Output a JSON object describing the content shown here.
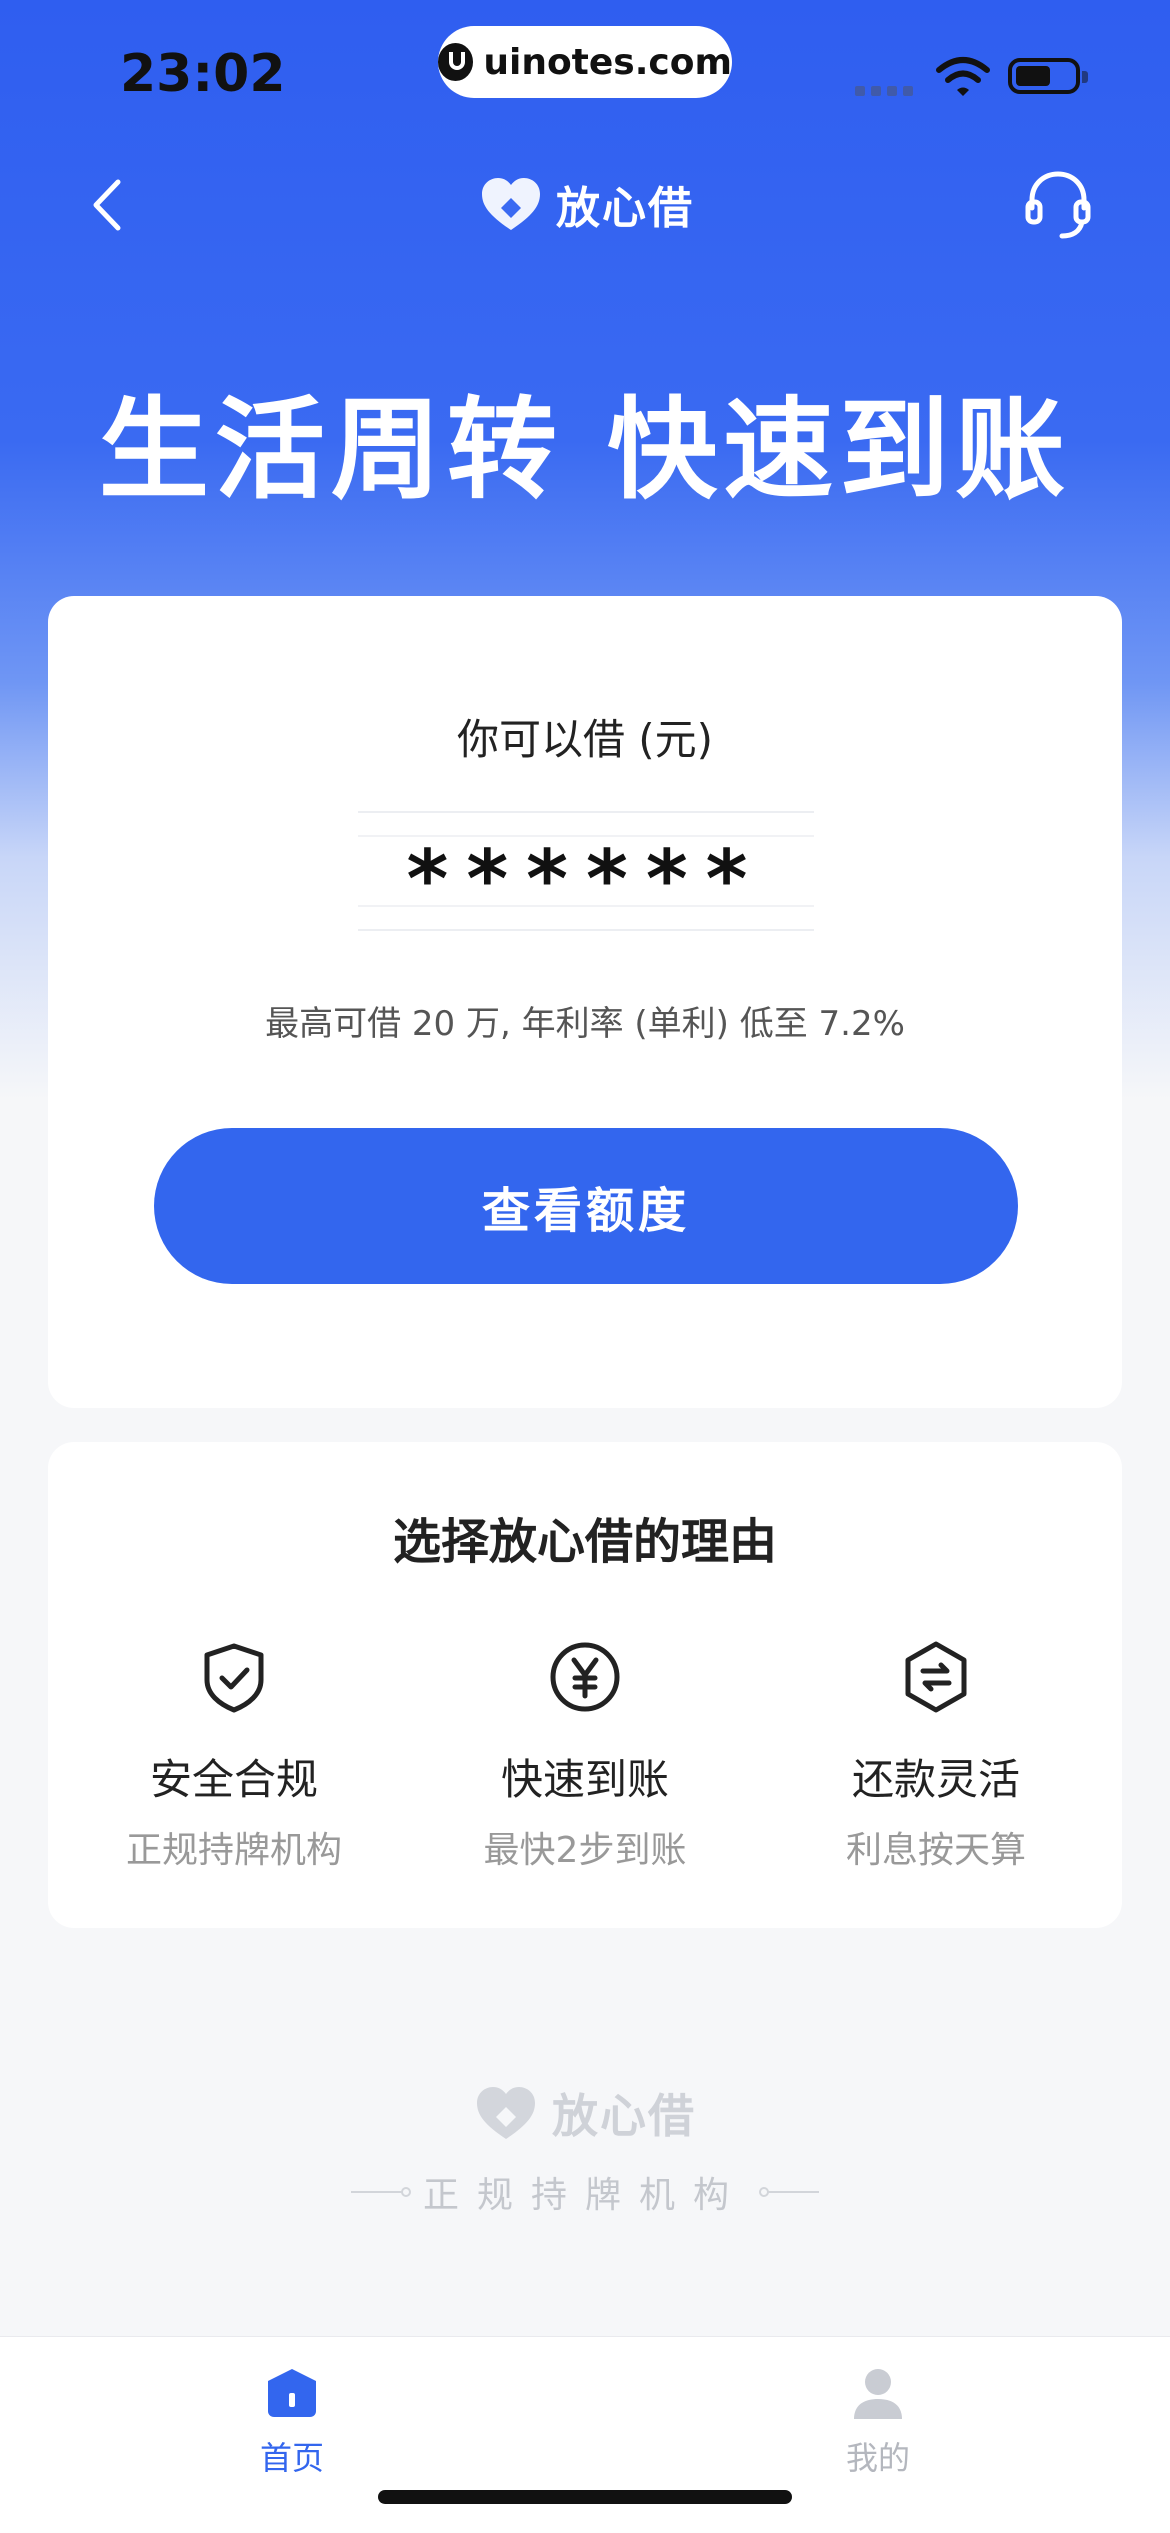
{
  "status_bar": {
    "time": "23:02",
    "url": "uinotes.com"
  },
  "nav": {
    "brand": "放心借",
    "back_icon": "chevron-left-icon",
    "support_icon": "headset-icon"
  },
  "hero": {
    "headline": "生活周转 快速到账"
  },
  "loan_card": {
    "label": "你可以借 (元)",
    "amount_masked": "******",
    "rate_note": "最高可借 20 万, 年利率 (单利) 低至 7.2%",
    "cta": "查看额度"
  },
  "reasons": {
    "title": "选择放心借的理由",
    "items": [
      {
        "title": "安全合规",
        "subtitle": "正规持牌机构",
        "icon": "shield-check-icon"
      },
      {
        "title": "快速到账",
        "subtitle": "最快2步到账",
        "icon": "yuan-circle-icon"
      },
      {
        "title": "还款灵活",
        "subtitle": "利息按天算",
        "icon": "hexagon-swap-icon"
      }
    ]
  },
  "footer": {
    "brand": "放心借",
    "tagline": "正规持牌机构"
  },
  "tab_bar": {
    "items": [
      {
        "label": "首页",
        "active": true,
        "icon": "home-icon"
      },
      {
        "label": "我的",
        "active": false,
        "icon": "user-icon"
      }
    ]
  },
  "colors": {
    "primary": "#3366EE",
    "hero_top": "#2F5EF0",
    "background": "#F6F7F9"
  }
}
